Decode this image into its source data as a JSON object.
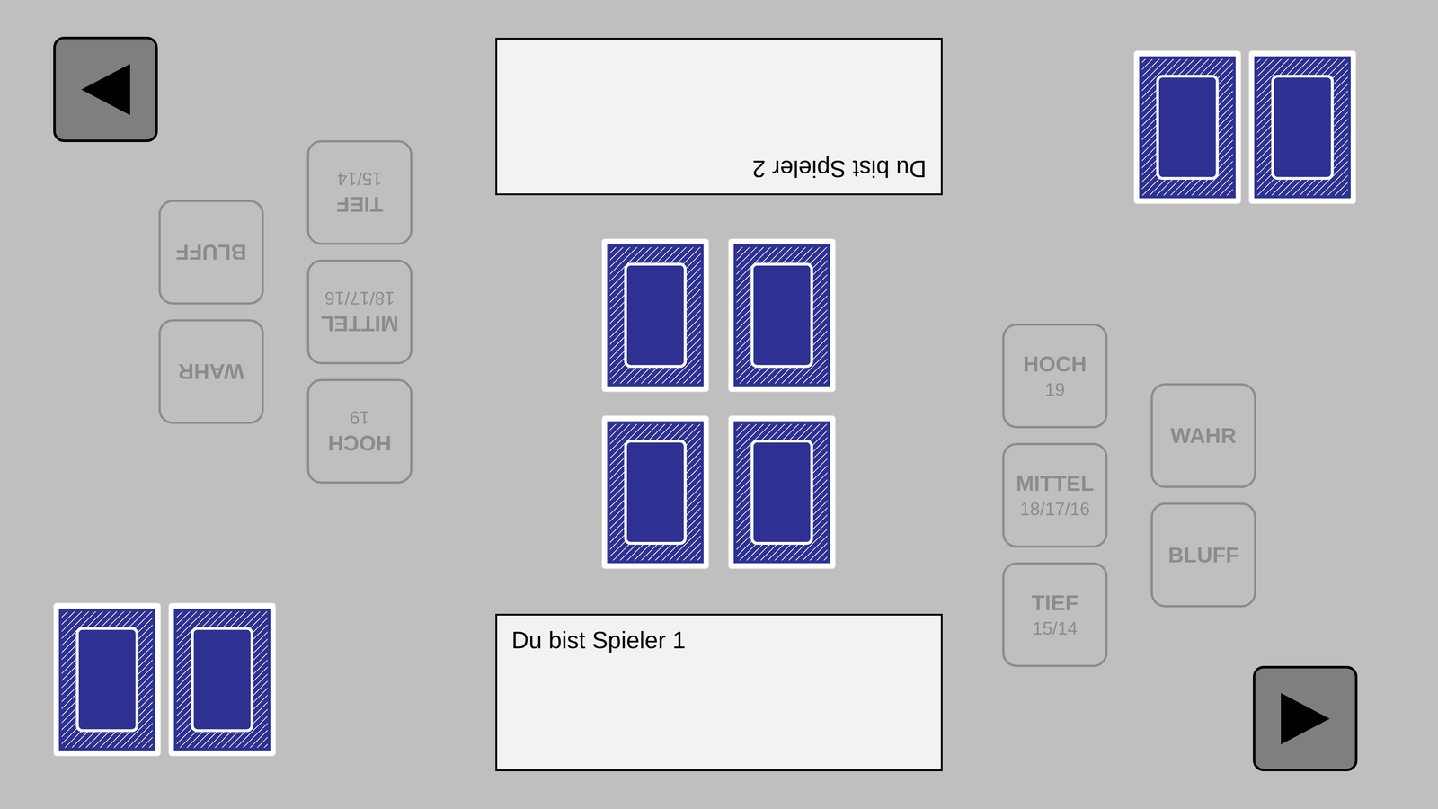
{
  "players": [
    {
      "message": "Du bist Spieler 2",
      "rotated": true,
      "hand": [
        {
          "face_down": true
        },
        {
          "face_down": true
        }
      ],
      "bets": [
        {
          "label": "HOCH",
          "range": "19",
          "disabled": true
        },
        {
          "label": "MITTEL",
          "range": "18/17/16",
          "disabled": true
        },
        {
          "label": "TIEF",
          "range": "15/14",
          "disabled": true
        }
      ],
      "calls": [
        {
          "label": "WAHR",
          "disabled": true
        },
        {
          "label": "BLUFF",
          "disabled": true
        }
      ]
    },
    {
      "message": "Du bist Spieler 1",
      "rotated": false,
      "hand": [
        {
          "face_down": true
        },
        {
          "face_down": true
        }
      ],
      "bets": [
        {
          "label": "HOCH",
          "range": "19",
          "disabled": true
        },
        {
          "label": "MITTEL",
          "range": "18/17/16",
          "disabled": true
        },
        {
          "label": "TIEF",
          "range": "15/14",
          "disabled": true
        }
      ],
      "calls": [
        {
          "label": "WAHR",
          "disabled": true
        },
        {
          "label": "BLUFF",
          "disabled": true
        }
      ]
    }
  ],
  "table": {
    "cards": [
      {
        "face_down": true
      },
      {
        "face_down": true
      },
      {
        "face_down": true
      },
      {
        "face_down": true
      }
    ]
  }
}
